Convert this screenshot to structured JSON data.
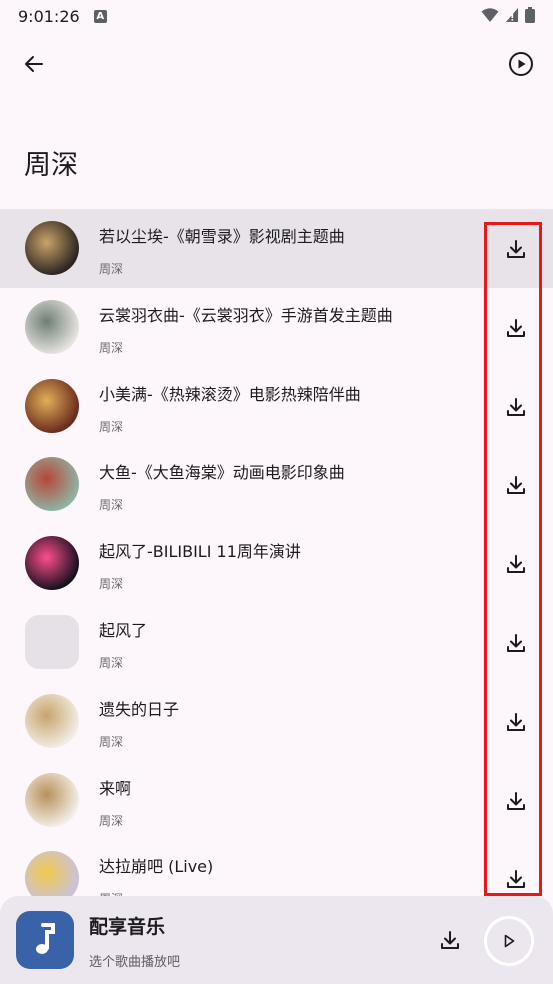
{
  "status": {
    "time": "9:01:26",
    "notif": "A"
  },
  "header": {
    "title": "周深"
  },
  "songs": [
    {
      "title": "若以尘埃-《朝雪录》影视剧主题曲",
      "artist": "周深",
      "cover": [
        "#2b2420",
        "#c9a46a"
      ]
    },
    {
      "title": "云裳羽衣曲-《云裳羽衣》手游首发主题曲",
      "artist": "周深",
      "cover": [
        "#e6e3e0",
        "#6e7f75"
      ]
    },
    {
      "title": "小美满-《热辣滚烫》电影热辣陪伴曲",
      "artist": "周深",
      "cover": [
        "#6b2a1c",
        "#e0b05a"
      ]
    },
    {
      "title": "大鱼-《大鱼海棠》动画电影印象曲",
      "artist": "周深",
      "cover": [
        "#8fb4a2",
        "#b8463a"
      ]
    },
    {
      "title": "起风了-BILIBILI 11周年演讲",
      "artist": "周深",
      "cover": [
        "#16101f",
        "#ff4d8d"
      ]
    },
    {
      "title": "起风了",
      "artist": "周深",
      "cover": null
    },
    {
      "title": "遗失的日子",
      "artist": "周深",
      "cover": [
        "#f2ede6",
        "#c8a46a"
      ]
    },
    {
      "title": "来啊",
      "artist": "周深",
      "cover": [
        "#f3eee8",
        "#b89158"
      ]
    },
    {
      "title": "达拉崩吧 (Live)",
      "artist": "周深",
      "cover": [
        "#c9c2de",
        "#f2c94c"
      ]
    }
  ],
  "player": {
    "title": "配享音乐",
    "subtitle": "选个歌曲播放吧"
  },
  "colors": {
    "highlight": "#e51919",
    "accent": "#3a62a8",
    "active_row": "#e8e3e8"
  }
}
